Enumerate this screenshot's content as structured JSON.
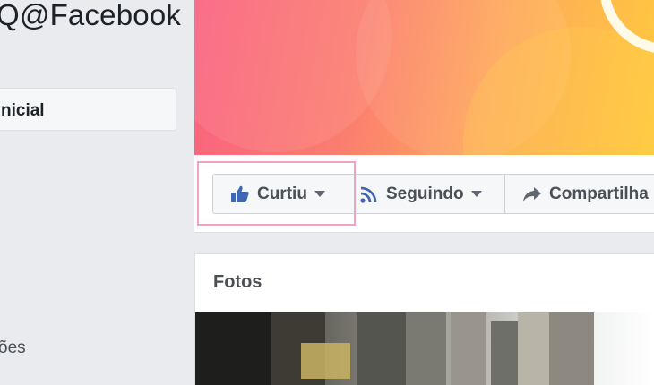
{
  "sidebar": {
    "page_handle": "Q@Facebook",
    "nav_active_label": "nicial",
    "nav_partial_label": "ões"
  },
  "cover": {
    "colors": [
      "#f9627f",
      "#fea95a",
      "#ffc93f"
    ]
  },
  "actions": {
    "like_label": "Curtiu",
    "follow_label": "Seguindo",
    "share_label": "Compartilha",
    "like_icon": "thumbs-up-icon",
    "follow_icon": "rss-icon",
    "share_icon": "share-arrow-icon",
    "accent": "#4267b2"
  },
  "photos": {
    "title": "Fotos"
  }
}
